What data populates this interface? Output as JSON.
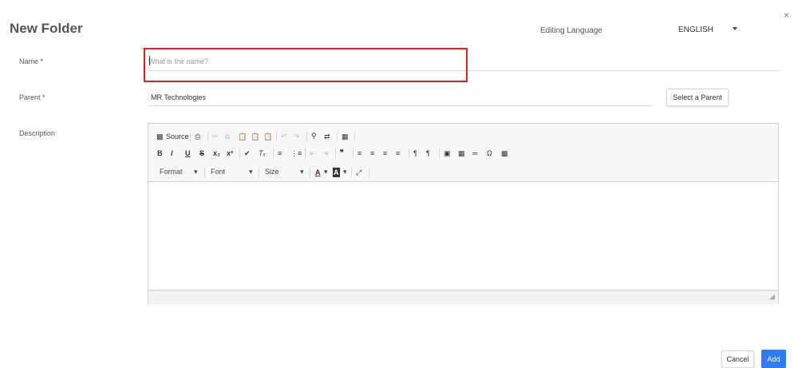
{
  "dialog": {
    "title": "New Folder",
    "close_glyph": "×",
    "editing_language_label": "Editing Language",
    "language_value": "ENGLISH"
  },
  "form": {
    "name_label": "Name *",
    "name_placeholder": "What is the name?",
    "name_value": "",
    "parent_label": "Parent  *",
    "parent_value": "MR Technologies",
    "select_parent_label": "Select a Parent",
    "description_label": "Description"
  },
  "editor": {
    "toolbar_row1": {
      "source_label": "Source",
      "icons": [
        "source-icon",
        "print-icon",
        "cut-icon",
        "copy-icon",
        "paste-icon",
        "paste-text-icon",
        "paste-word-icon",
        "undo-icon",
        "redo-icon",
        "find-icon",
        "replace-icon",
        "select-all-icon"
      ]
    },
    "toolbar_row2": {
      "bold": "B",
      "italic": "I",
      "underline": "U",
      "strike": "S",
      "subscript": "x₂",
      "superscript": "x²"
    },
    "toolbar_row3": {
      "format_label": "Format",
      "font_label": "Font",
      "size_label": "Size",
      "text_color": "A",
      "bg_color": "A"
    }
  },
  "footer": {
    "cancel_label": "Cancel",
    "add_label": "Add"
  },
  "colors": {
    "accent": "#2f7df6",
    "highlight": "#e02020"
  }
}
